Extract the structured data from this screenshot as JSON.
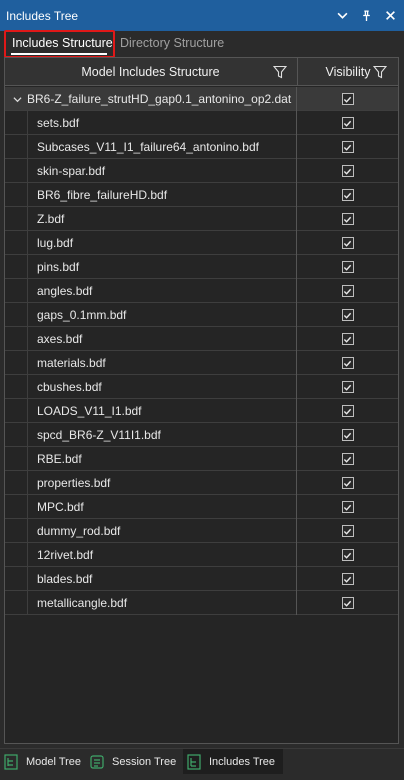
{
  "window": {
    "title": "Includes Tree"
  },
  "title_buttons": {
    "dropdown_icon": "chevron-down-icon",
    "pin_icon": "pin-icon",
    "close_icon": "close-icon"
  },
  "tabs": [
    {
      "label": "Includes Structure",
      "active": true
    },
    {
      "label": "Directory Structure",
      "active": false
    }
  ],
  "grid": {
    "columns": [
      {
        "label": "Model Includes Structure",
        "icon": "filter-icon"
      },
      {
        "label": "Visibility",
        "icon": "filter-icon"
      }
    ],
    "root": {
      "name": "BR6-Z_failure_strutHD_gap0.1_antonino_op2.dat",
      "visible": true,
      "expanded": true
    },
    "children": [
      {
        "name": "sets.bdf",
        "visible": true
      },
      {
        "name": "Subcases_V11_I1_failure64_antonino.bdf",
        "visible": true
      },
      {
        "name": "skin-spar.bdf",
        "visible": true
      },
      {
        "name": "BR6_fibre_failureHD.bdf",
        "visible": true
      },
      {
        "name": "Z.bdf",
        "visible": true
      },
      {
        "name": "lug.bdf",
        "visible": true
      },
      {
        "name": "pins.bdf",
        "visible": true
      },
      {
        "name": "angles.bdf",
        "visible": true
      },
      {
        "name": "gaps_0.1mm.bdf",
        "visible": true
      },
      {
        "name": "axes.bdf",
        "visible": true
      },
      {
        "name": "materials.bdf",
        "visible": true
      },
      {
        "name": "cbushes.bdf",
        "visible": true
      },
      {
        "name": "LOADS_V11_I1.bdf",
        "visible": true
      },
      {
        "name": "spcd_BR6-Z_V11I1.bdf",
        "visible": true
      },
      {
        "name": "RBE.bdf",
        "visible": true
      },
      {
        "name": "properties.bdf",
        "visible": true
      },
      {
        "name": "MPC.bdf",
        "visible": true
      },
      {
        "name": "dummy_rod.bdf",
        "visible": true
      },
      {
        "name": "12rivet.bdf",
        "visible": true
      },
      {
        "name": "blades.bdf",
        "visible": true
      },
      {
        "name": "metallicangle.bdf",
        "visible": true
      }
    ]
  },
  "bottom_tabs": [
    {
      "label": "Model Tree",
      "icon": "model-tree-icon",
      "active": false
    },
    {
      "label": "Session Tree",
      "icon": "session-tree-icon",
      "active": false
    },
    {
      "label": "Includes Tree",
      "icon": "includes-tree-icon",
      "active": true
    }
  ],
  "colors": {
    "titlebar": "#1f5f9e",
    "highlight": "#e01818",
    "icon_green": "#3fa86a"
  }
}
